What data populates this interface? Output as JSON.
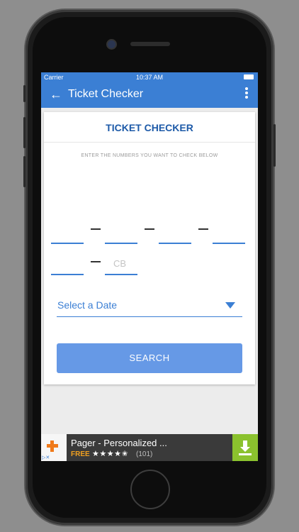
{
  "status_bar": {
    "carrier": "Carrier",
    "time": "10:37 AM"
  },
  "app_bar": {
    "back_glyph": "←",
    "title": "Ticket Checker",
    "menu_icon": "more-vertical-icon"
  },
  "card": {
    "heading": "TICKET CHECKER",
    "instruction": "ENTER THE NUMBERS YOU WANT TO CHECK BELOW",
    "cb_placeholder": "CB",
    "date_placeholder": "Select a Date",
    "search_label": "SEARCH"
  },
  "ad": {
    "title": "Pager - Personalized ...",
    "price": "FREE",
    "stars": "★★★★✬",
    "reviews": "(101)",
    "adchoices_icon": "adchoices-icon",
    "download_icon": "download-icon"
  },
  "colors": {
    "primary": "#3b7fd4",
    "button": "#6699e6",
    "heading": "#1d5aa8",
    "ad_bg": "#3a3a3a",
    "ad_download": "#8bc22e",
    "ad_free": "#f0a020"
  }
}
